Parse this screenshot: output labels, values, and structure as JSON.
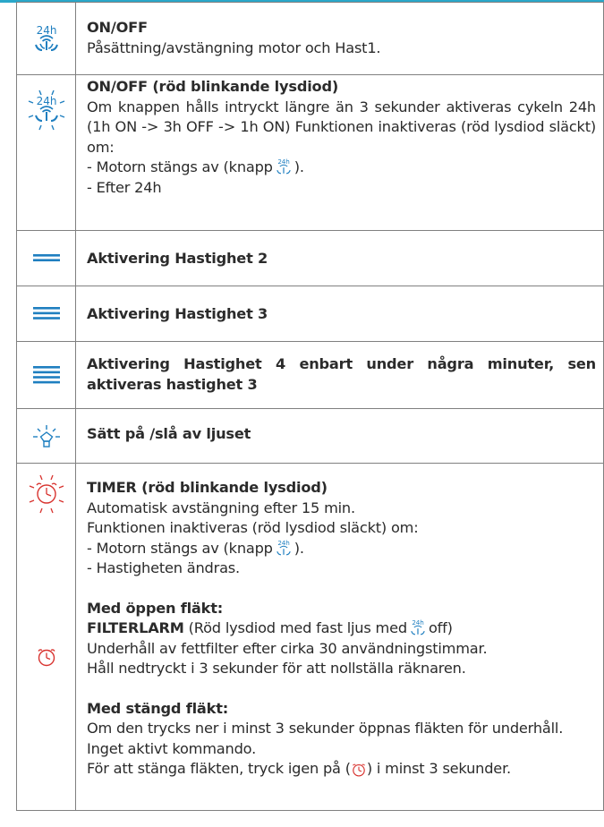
{
  "colors": {
    "accent": "#2aa7c9",
    "icon_blue": "#1f7fc0",
    "icon_red": "#d8332f",
    "border": "#808080"
  },
  "rows": {
    "onoff": {
      "icon": "24h-fan-icon",
      "title": "ON/OFF",
      "text": "Påsättning/avstängning motor och Hast1."
    },
    "onoff_red": {
      "icon": "24h-fan-blinking-icon",
      "title": "ON/OFF (röd blinkande lysdiod)",
      "text": "Om knappen hålls intryckt längre än 3 sekunder aktiveras cykeln 24h (1h ON -> 3h OFF -> 1h ON) Funktionen inaktiveras (röd lysdiod släckt) om:",
      "bullet1_pre": "- Motorn stängs av (knapp",
      "bullet1_post": ").",
      "bullet2": "- Efter 24h"
    },
    "speed2": {
      "icon": "two-lines-icon",
      "title": "Aktivering Hastighet 2"
    },
    "speed3": {
      "icon": "three-lines-icon",
      "title": "Aktivering Hastighet 3"
    },
    "speed4": {
      "icon": "four-lines-icon",
      "title": "Aktivering Hastighet 4 enbart under några minuter, sen aktiveras hastighet 3"
    },
    "light": {
      "icon": "light-bulb-icon",
      "title": "Sätt på /slå av ljuset"
    },
    "timer": {
      "icon": "timer-blinking-icon",
      "title": "TIMER (röd blinkande lysdiod)",
      "line1": "Automatisk avstängning efter 15 min.",
      "line2": "Funktionen inaktiveras (röd lysdiod släckt) om:",
      "bullet1_pre": "- Motorn stängs av (knapp",
      "bullet1_post": ").",
      "bullet2": "- Hastigheten ändras.",
      "open_title": "Med öppen fläkt:",
      "filter_title": "FILTERLARM",
      "filter_pre": "(Röd lysdiod med fast ljus med",
      "filter_post": "off)",
      "filter_line2": "Underhåll av fettfilter efter cirka 30 användningstimmar.",
      "filter_line3": "Håll nedtryckt i 3 sekunder för att nollställa räknaren.",
      "closed_title": "Med stängd fläkt:",
      "closed_line1": "Om den trycks ner i minst 3 sekunder öppnas fläkten för underhåll.",
      "closed_line2": "Inget aktivt kommando.",
      "closed_line3_pre": "För att stänga fläkten, tryck igen på (",
      "closed_line3_post": ") i minst 3 sekunder.",
      "icon2": "timer-icon"
    },
    "icon_label_24h": "24h"
  }
}
